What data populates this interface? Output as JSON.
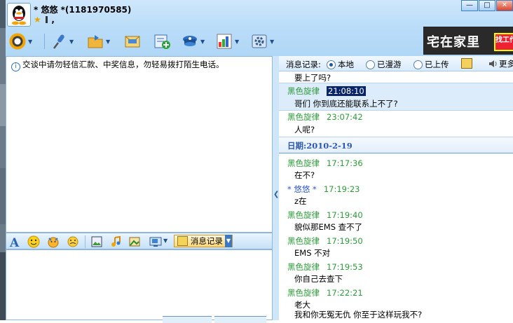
{
  "window": {
    "title": "* 悠悠 *(1181970585)",
    "subtitle": ",",
    "controls": [
      "—",
      "□",
      "✕"
    ]
  },
  "toolbar": {
    "icons": [
      "video-call-icon",
      "voice-call-icon",
      "send-file-icon",
      "send-message-icon",
      "add-contact-icon",
      "app-icon",
      "color-theme-icon",
      "settings-icon"
    ]
  },
  "banner": {
    "text": "宅在家里",
    "badge": "找工作"
  },
  "chat": {
    "notice": "交谈中请勿轻信汇款、中奖信息，勿轻易拨打陌生电话。"
  },
  "input_toolbar": {
    "history_button": "消息记录"
  },
  "history": {
    "label": "消息记录:",
    "options": [
      "本地",
      "已漫游",
      "已上传"
    ],
    "selected": "本地",
    "more": "更多",
    "top_text": "要上了吗?",
    "messages_before": [
      {
        "sender": "黑色旋律",
        "time": "21:08:10",
        "text": "哥们 你到底还能联系上不了?"
      },
      {
        "sender": "黑色旋律",
        "time": "23:07:42",
        "text": "人呢?"
      }
    ],
    "date": "日期:2010-2-19",
    "messages_after": [
      {
        "sender": "黑色旋律",
        "time": "17:17:36",
        "text": "在不?"
      },
      {
        "sender": "* 悠悠 *",
        "time": "17:19:23",
        "text": "z在"
      },
      {
        "sender": "黑色旋律",
        "time": "17:19:40",
        "text": "貌似那EMS 查不了"
      },
      {
        "sender": "黑色旋律",
        "time": "17:19:50",
        "text": "EMS 不对"
      },
      {
        "sender": "黑色旋律",
        "time": "17:19:53",
        "text": "你自己去查下"
      },
      {
        "sender": "黑色旋律",
        "time": "17:22:21",
        "text": "老大"
      }
    ],
    "last_partial": "我和你无冤无仇 你至于这样玩我不?"
  },
  "colors": {
    "other_sender": "#2f9a3b",
    "self_sender": "#2e54c7",
    "date_color": "#2c58b4",
    "highlight": "#0a246a"
  }
}
